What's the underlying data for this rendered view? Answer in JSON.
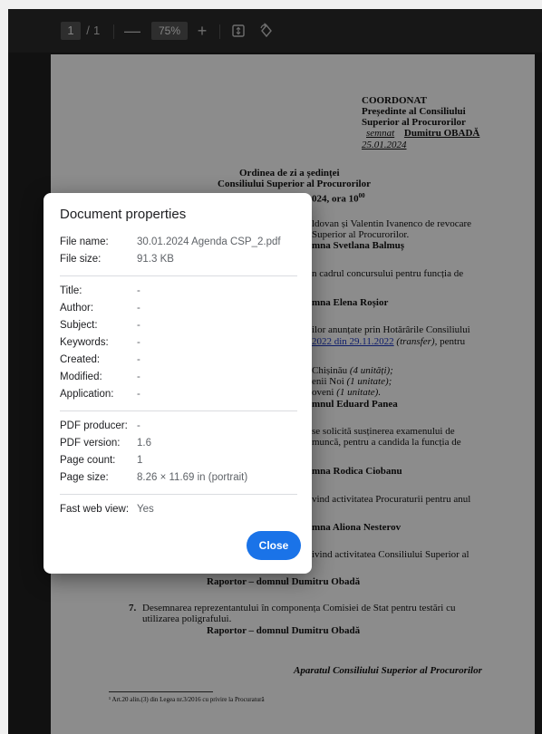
{
  "toolbar": {
    "page_current": "1",
    "page_separator": "/",
    "page_total": "1",
    "zoom_out_label": "—",
    "zoom_value": "75%",
    "zoom_in_label": "+",
    "fit_icon": "fit-page-icon",
    "rotate_icon": "rotate-icon"
  },
  "document": {
    "approval": {
      "heading": "COORDONAT",
      "line1": "Președinte al Consiliului",
      "line2": "Superior al Procurorilor",
      "signed_word": "semnat",
      "signer": "Dumitru OBADĂ",
      "date": "25.01.2024"
    },
    "agenda_title": "Ordinea de zi a ședinței",
    "agenda_body": "Consiliului Superior al Procurorilor",
    "agenda_datetime": "024, ora 10",
    "agenda_datetime_sup": "00",
    "fragments": [
      "ldovan și Valentin Ivanenco de revocare",
      "Superior al Procurorilor.",
      "mna Svetlana Balmuș",
      "n cadrul concursului pentru funcția de",
      "mna Elena Roșior",
      "ilor anunțate prin Hotărârile Consiliului",
      "pentru",
      "Chișinău",
      "(4 unități);",
      "enii Noi",
      "(1 unitate);",
      "oveni",
      "(1 unitate).",
      "mnul Eduard Panea",
      "se solicită susținerea examenului de",
      "muncă, pentru a candida la funcția de",
      "mna Rodica Ciobanu",
      "vind activitatea Procuraturii pentru anul",
      "mna Aliona Nesterov",
      "ivind activitatea Consiliului Superior al",
      "Raportor – domnul Dumitru Obadă",
      "7.",
      "Desemnarea reprezentantului în componența Comisiei de Stat pentru testări cu",
      "utilizarea poligrafului.",
      "Raportor – domnul Dumitru Obadă",
      "Aparatul Consiliului Superior al Procurorilor"
    ],
    "link_text": "2022 din 29.11.2022",
    "transfer_text": "(transfer),",
    "footnote": "¹ Art.20 alin.(3) din Legea nr.3/2016 cu privire la Procuratură"
  },
  "dialog": {
    "title": "Document properties",
    "rows": [
      {
        "key": "File name:",
        "value": "30.01.2024 Agenda CSP_2.pdf"
      },
      {
        "key": "File size:",
        "value": "91.3 KB"
      },
      {
        "key": "Title:",
        "value": "-"
      },
      {
        "key": "Author:",
        "value": "-"
      },
      {
        "key": "Subject:",
        "value": "-"
      },
      {
        "key": "Keywords:",
        "value": "-"
      },
      {
        "key": "Created:",
        "value": "-"
      },
      {
        "key": "Modified:",
        "value": "-"
      },
      {
        "key": "Application:",
        "value": "-"
      },
      {
        "key": "PDF producer:",
        "value": "-"
      },
      {
        "key": "PDF version:",
        "value": "1.6"
      },
      {
        "key": "Page count:",
        "value": "1"
      },
      {
        "key": "Page size:",
        "value": "8.26 × 11.69 in (portrait)"
      },
      {
        "key": "Fast web view:",
        "value": "Yes"
      }
    ],
    "close_label": "Close"
  },
  "colors": {
    "accent": "#1a73e8",
    "viewer_bg": "#1f1f1f",
    "toolbar_bg": "#2a2a2a"
  }
}
